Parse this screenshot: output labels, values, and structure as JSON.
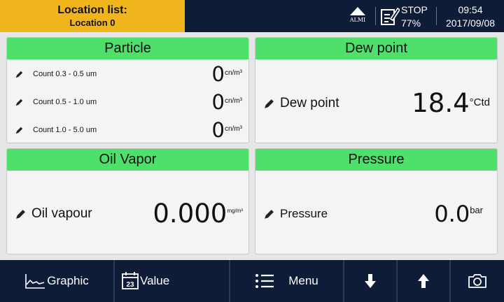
{
  "header": {
    "location_title": "Location list:",
    "location_name": "Location 0",
    "alarm_label": "ALMI",
    "status_text": "STOP",
    "status_percent": "77%",
    "time": "09:54",
    "date": "2017/09/08",
    "icons": [
      "alarm-triangle-icon",
      "edit-document-icon"
    ]
  },
  "panels": {
    "particle": {
      "title": "Particle",
      "rows": [
        {
          "label": "Count 0.3 - 0.5 um",
          "value": "0",
          "unit": "cn/m³"
        },
        {
          "label": "Count 0.5 - 1.0 um",
          "value": "0",
          "unit": "cn/m³"
        },
        {
          "label": "Count 1.0 - 5.0 um",
          "value": "0",
          "unit": "cn/m³"
        }
      ]
    },
    "dew_point": {
      "title": "Dew point",
      "label": "Dew point",
      "value": "18.4",
      "unit": "°Ctd"
    },
    "oil_vapor": {
      "title": "Oil Vapor",
      "label": "Oil vapour",
      "value": "0.000",
      "unit": "mg/m³"
    },
    "pressure": {
      "title": "Pressure",
      "label": "Pressure",
      "value": "0.0",
      "unit": "bar"
    }
  },
  "footer": {
    "graphic_label": "Graphic",
    "value_icon_text": "23",
    "value_label": "Value",
    "menu_label": "Menu",
    "icons": [
      "chart-line-icon",
      "calendar-value-icon",
      "menu-list-icon",
      "arrow-down-icon",
      "arrow-up-icon",
      "camera-icon"
    ]
  },
  "colors": {
    "header_bg": "#0f1c38",
    "location_bg": "#f0b41c",
    "panel_title_bg": "#4ee06a",
    "panel_bg": "#f4f4f4"
  }
}
